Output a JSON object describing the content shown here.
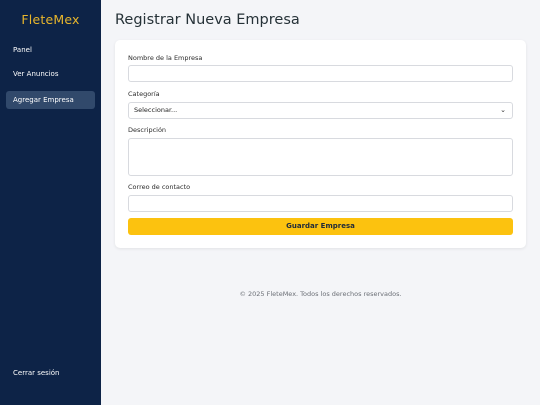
{
  "sidebar": {
    "brand": "FleteMex",
    "items": [
      {
        "label": "Panel"
      },
      {
        "label": "Ver Anuncios"
      },
      {
        "label": "Agregar Empresa"
      }
    ],
    "logout_label": "Cerrar sesión"
  },
  "main": {
    "title": "Registrar Nueva Empresa",
    "form": {
      "nombre_label": "Nombre de la Empresa",
      "nombre_value": "",
      "categoria_label": "Categoría",
      "categoria_selected": "Seleccionar...",
      "descripcion_label": "Descripción",
      "descripcion_value": "",
      "correo_label": "Correo de contacto",
      "correo_value": "",
      "submit_label": "Guardar Empresa"
    }
  },
  "footer": {
    "text": "© 2025 FleteMex. Todos los derechos reservados."
  },
  "colors": {
    "sidebar_bg": "#0d2347",
    "brand": "#e8b62c",
    "active_item": "#31496b",
    "button": "#fcc20f",
    "page_bg": "#f4f5f8"
  },
  "icons": {
    "select_chevron": "chevron-down-icon",
    "textarea_grip": "resize-grip-icon"
  }
}
